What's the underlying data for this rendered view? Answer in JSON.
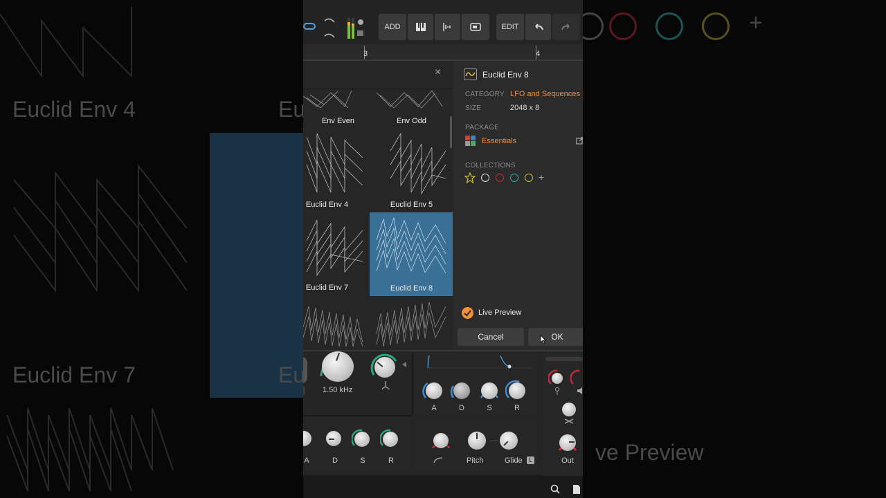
{
  "background": {
    "left_labels": [
      "Euclid Env 4",
      "Euclid Env 7"
    ],
    "left_cut_labels": [
      "Eu",
      "Eu"
    ],
    "right_label": "ve Preview"
  },
  "toolbar": {
    "add_label": "ADD",
    "edit_label": "EDIT"
  },
  "ruler": {
    "marks": [
      "3",
      "4"
    ]
  },
  "browser": {
    "close_glyph": "×",
    "items": [
      {
        "label": "Env Even",
        "selected": false
      },
      {
        "label": "Env Odd",
        "selected": false
      },
      {
        "label": "Euclid Env 4",
        "selected": false
      },
      {
        "label": "Euclid Env 5",
        "selected": false
      },
      {
        "label": "Euclid Env 7",
        "selected": false
      },
      {
        "label": "Euclid Env 8",
        "selected": true
      }
    ]
  },
  "inspector": {
    "title": "Euclid Env 8",
    "category_label": "CATEGORY",
    "category_value": "LFO and Sequences",
    "size_label": "SIZE",
    "size_value": "2048 x 8",
    "package_label": "PACKAGE",
    "package_value": "Essentials",
    "collections_label": "COLLECTIONS",
    "collections_add": "+",
    "collection_colors": [
      "#e0e0e0",
      "#c8283c",
      "#2bb0b0",
      "#c8c030"
    ],
    "star_color": "#c8c030",
    "live_preview_label": "Live Preview",
    "live_preview_checked": true,
    "cancel_label": "Cancel",
    "ok_label": "OK"
  },
  "devices": {
    "freq_value": "1.50 kHz",
    "env1_labels": [
      "A",
      "D",
      "S",
      "R"
    ],
    "env2_labels": [
      "A",
      "D",
      "S",
      "R"
    ],
    "pitch_label": "Pitch",
    "glide_label": "Glide",
    "glide_badge": "L",
    "out_label": "Out"
  },
  "colors": {
    "accent_orange": "#f0913a",
    "selection_blue": "#3a6f96",
    "ring_green": "#2ea67a",
    "ring_blue": "#3f8fd6",
    "ring_red": "#c8283c"
  }
}
